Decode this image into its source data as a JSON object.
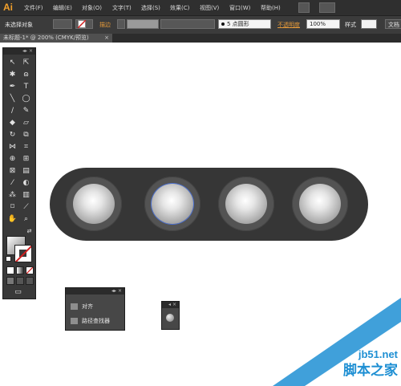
{
  "app": {
    "logo": "Ai"
  },
  "menu": [
    "文件(F)",
    "编辑(E)",
    "对象(O)",
    "文字(T)",
    "选择(S)",
    "效果(C)",
    "视图(V)",
    "窗口(W)",
    "帮助(H)"
  ],
  "control": {
    "no_selection": "未选择对象",
    "stroke_label": "描边",
    "brush_value": "5 点圆形",
    "opacity_label": "不透明度",
    "opacity_value": "100%",
    "style_label": "样式",
    "doc_label": "文档"
  },
  "document": {
    "tab_title": "未标题-1* @ 200% (CMYK/预览)",
    "close": "×"
  },
  "panels": {
    "align_pathfinder": {
      "items": [
        "对齐",
        "路径查找器"
      ]
    }
  },
  "colors": {
    "accent": "#e59a3a",
    "selection": "#4a6fd1",
    "pill": "#363636"
  },
  "watermark": {
    "site": "jb51.net",
    "name": "脚本之家"
  }
}
